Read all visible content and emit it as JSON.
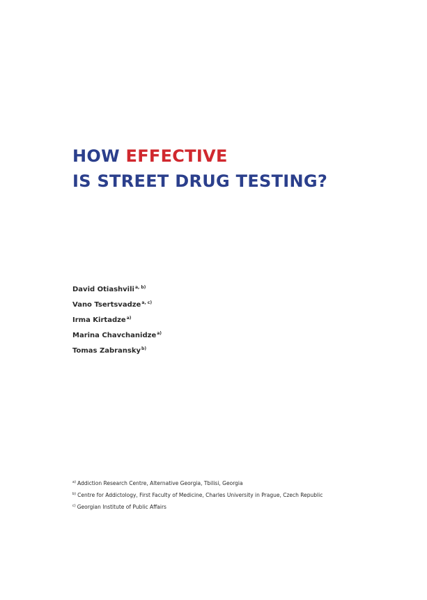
{
  "title": {
    "line1_plain": "HOW ",
    "line1_accent": "EFFECTIVE",
    "line2": "IS STREET DRUG TESTING?"
  },
  "authors": [
    {
      "name": "David Otiashvili",
      "affil": "a, b)"
    },
    {
      "name": "Vano Tsertsvadze",
      "affil": "a, c)"
    },
    {
      "name": "Irma Kirtadze",
      "affil": "a)"
    },
    {
      "name": "Marina Chavchanidze",
      "affil": "a)"
    },
    {
      "name": "Tomas Zabransky",
      "affil": "b)"
    }
  ],
  "affiliations": [
    {
      "mark": "a)",
      "text": "Addiction Research Centre, Alternative Georgia, Tbilisi, Georgia"
    },
    {
      "mark": "b)",
      "text": "Centre for Addictology, First Faculty of Medicine, Charles University in Prague, Czech Republic"
    },
    {
      "mark": "c)",
      "text": "Georgian Institute of Public Affairs"
    }
  ],
  "colors": {
    "title_primary": "#2b3f8c",
    "title_accent": "#d0282e"
  }
}
